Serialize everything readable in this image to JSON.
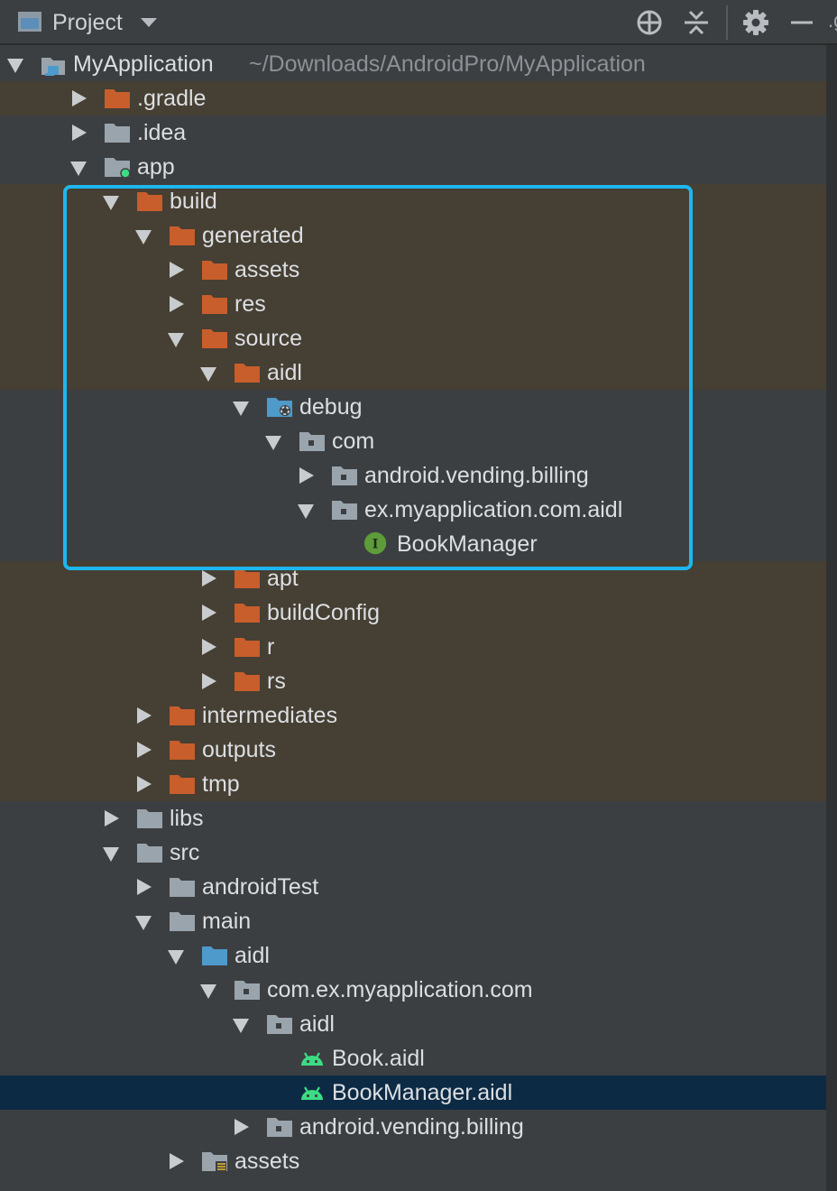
{
  "toolbar": {
    "view_label": "Project",
    "locate_icon": "crosshair-icon",
    "collapse_icon": "collapse-all-icon",
    "settings_icon": "gear-icon",
    "hide_icon": "minimize-icon",
    "cut_text": ".g"
  },
  "project": {
    "name": "MyApplication",
    "path": "~/Downloads/AndroidPro/MyApplication"
  },
  "tree": [
    {
      "label": ".gradle",
      "depth": 1,
      "arrow": "right",
      "icon": "folder-orange",
      "excluded": true
    },
    {
      "label": ".idea",
      "depth": 1,
      "arrow": "right",
      "icon": "folder-gray",
      "excluded": false
    },
    {
      "label": "app",
      "depth": 1,
      "arrow": "down",
      "icon": "module",
      "excluded": false
    },
    {
      "label": "build",
      "depth": 2,
      "arrow": "down",
      "icon": "folder-orange",
      "excluded": true
    },
    {
      "label": "generated",
      "depth": 3,
      "arrow": "down",
      "icon": "folder-orange",
      "excluded": true
    },
    {
      "label": "assets",
      "depth": 4,
      "arrow": "right",
      "icon": "folder-orange",
      "excluded": true
    },
    {
      "label": "res",
      "depth": 4,
      "arrow": "right",
      "icon": "folder-orange",
      "excluded": true
    },
    {
      "label": "source",
      "depth": 4,
      "arrow": "down",
      "icon": "folder-orange",
      "excluded": true
    },
    {
      "label": "aidl",
      "depth": 5,
      "arrow": "down",
      "icon": "folder-orange",
      "excluded": true
    },
    {
      "label": "debug",
      "depth": 6,
      "arrow": "down",
      "icon": "folder-generated",
      "excluded": false
    },
    {
      "label": "com",
      "depth": 7,
      "arrow": "down",
      "icon": "package",
      "excluded": false
    },
    {
      "label": "android.vending.billing",
      "depth": 8,
      "arrow": "right",
      "icon": "package",
      "excluded": false
    },
    {
      "label": "ex.myapplication.com.aidl",
      "depth": 8,
      "arrow": "down",
      "icon": "package",
      "excluded": false
    },
    {
      "label": "BookManager",
      "depth": 9,
      "arrow": "none",
      "icon": "interface",
      "excluded": false
    },
    {
      "label": "apt",
      "depth": 5,
      "arrow": "right",
      "icon": "folder-orange",
      "excluded": true
    },
    {
      "label": "buildConfig",
      "depth": 5,
      "arrow": "right",
      "icon": "folder-orange",
      "excluded": true
    },
    {
      "label": "r",
      "depth": 5,
      "arrow": "right",
      "icon": "folder-orange",
      "excluded": true
    },
    {
      "label": "rs",
      "depth": 5,
      "arrow": "right",
      "icon": "folder-orange",
      "excluded": true
    },
    {
      "label": "intermediates",
      "depth": 3,
      "arrow": "right",
      "icon": "folder-orange",
      "excluded": true
    },
    {
      "label": "outputs",
      "depth": 3,
      "arrow": "right",
      "icon": "folder-orange",
      "excluded": true
    },
    {
      "label": "tmp",
      "depth": 3,
      "arrow": "right",
      "icon": "folder-orange",
      "excluded": true
    },
    {
      "label": "libs",
      "depth": 2,
      "arrow": "right",
      "icon": "folder-gray",
      "excluded": false
    },
    {
      "label": "src",
      "depth": 2,
      "arrow": "down",
      "icon": "folder-gray",
      "excluded": false
    },
    {
      "label": "androidTest",
      "depth": 3,
      "arrow": "right",
      "icon": "folder-gray",
      "excluded": false
    },
    {
      "label": "main",
      "depth": 3,
      "arrow": "down",
      "icon": "folder-gray",
      "excluded": false
    },
    {
      "label": "aidl",
      "depth": 4,
      "arrow": "down",
      "icon": "folder-blue",
      "excluded": false
    },
    {
      "label": "com.ex.myapplication.com",
      "depth": 5,
      "arrow": "down",
      "icon": "package",
      "excluded": false
    },
    {
      "label": "aidl",
      "depth": 6,
      "arrow": "down",
      "icon": "package",
      "excluded": false
    },
    {
      "label": "Book.aidl",
      "depth": 7,
      "arrow": "none",
      "icon": "android",
      "excluded": false
    },
    {
      "label": "BookManager.aidl",
      "depth": 7,
      "arrow": "none",
      "icon": "android",
      "excluded": false,
      "selected": true
    },
    {
      "label": "android.vending.billing",
      "depth": 6,
      "arrow": "right",
      "icon": "package",
      "excluded": false
    },
    {
      "label": "assets",
      "depth": 4,
      "arrow": "right",
      "icon": "folder-resources",
      "excluded": false
    }
  ],
  "colors": {
    "background": "#3c3f41",
    "excluded_row": "#463f33",
    "selected_row": "#0d2a44",
    "folder_orange": "#c75e2c",
    "folder_gray": "#9aa4ad",
    "folder_blue": "#4d9acb",
    "highlight_border": "#1db6f0",
    "android_green": "#3ddc84",
    "interface_green": "#5e9b3b"
  }
}
